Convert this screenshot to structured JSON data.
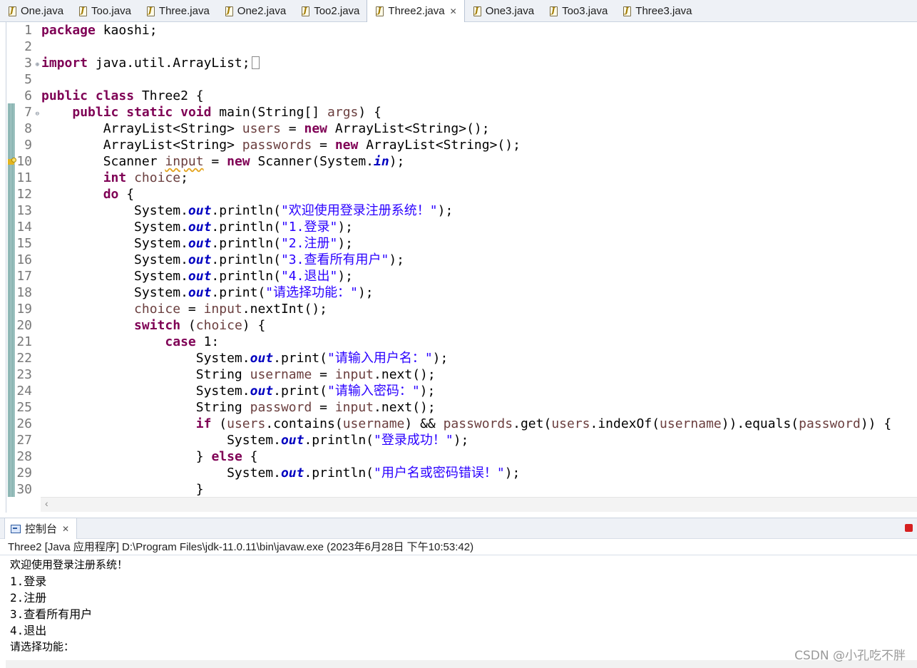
{
  "editor_tabs": [
    {
      "label": "One.java",
      "active": false
    },
    {
      "label": "Too.java",
      "active": false
    },
    {
      "label": "Three.java",
      "active": false
    },
    {
      "label": "One2.java",
      "active": false
    },
    {
      "label": "Too2.java",
      "active": false
    },
    {
      "label": "Three2.java",
      "active": true
    },
    {
      "label": "One3.java",
      "active": false
    },
    {
      "label": "Too3.java",
      "active": false
    },
    {
      "label": "Three3.java",
      "active": false
    }
  ],
  "close_glyph": "✕",
  "code": {
    "line_numbers": [
      "1",
      "2",
      "3",
      "5",
      "6",
      "7",
      "8",
      "9",
      "10",
      "11",
      "12",
      "13",
      "14",
      "15",
      "16",
      "17",
      "18",
      "19",
      "20",
      "21",
      "22",
      "23",
      "24",
      "25",
      "26",
      "27",
      "28",
      "29",
      "30"
    ],
    "lines": {
      "l1": {
        "kw": "package",
        "rest": " kaoshi;"
      },
      "l3": {
        "kw": "import",
        "rest": " java.util.ArrayList;"
      },
      "l6": {
        "kw1": "public",
        "kw2": "class",
        "rest": " Three2 {"
      },
      "l7": {
        "indent": "    ",
        "kw1": "public",
        "kw2": "static",
        "kw3": "void",
        "rest1": " main(String[] ",
        "args": "args",
        "rest2": ") {"
      },
      "l8": {
        "indent": "        ",
        "t1": "ArrayList<String> ",
        "v": "users",
        "t2": " = ",
        "kw": "new",
        "t3": " ArrayList<String>();"
      },
      "l9": {
        "indent": "        ",
        "t1": "ArrayList<String> ",
        "v": "passwords",
        "t2": " = ",
        "kw": "new",
        "t3": " ArrayList<String>();"
      },
      "l10": {
        "indent": "        ",
        "t1": "Scanner ",
        "v": "input",
        "t2": " = ",
        "kw": "new",
        "t3": " Scanner(System.",
        "fd": "in",
        "t4": ");"
      },
      "l11": {
        "indent": "        ",
        "kw": "int",
        "sp": " ",
        "v": "choice",
        "t": ";"
      },
      "l12": {
        "indent": "        ",
        "kw": "do",
        "t": " {"
      },
      "l13": {
        "indent": "            ",
        "t1": "System.",
        "fd": "out",
        "t2": ".println(",
        "s": "\"欢迎使用登录注册系统！\"",
        "t3": ");"
      },
      "l14": {
        "indent": "            ",
        "t1": "System.",
        "fd": "out",
        "t2": ".println(",
        "s": "\"1.登录\"",
        "t3": ");"
      },
      "l15": {
        "indent": "            ",
        "t1": "System.",
        "fd": "out",
        "t2": ".println(",
        "s": "\"2.注册\"",
        "t3": ");"
      },
      "l16": {
        "indent": "            ",
        "t1": "System.",
        "fd": "out",
        "t2": ".println(",
        "s": "\"3.查看所有用户\"",
        "t3": ");"
      },
      "l17": {
        "indent": "            ",
        "t1": "System.",
        "fd": "out",
        "t2": ".println(",
        "s": "\"4.退出\"",
        "t3": ");"
      },
      "l18": {
        "indent": "            ",
        "t1": "System.",
        "fd": "out",
        "t2": ".print(",
        "s": "\"请选择功能：\"",
        "t3": ");"
      },
      "l19": {
        "indent": "            ",
        "v1": "choice",
        "t1": " = ",
        "v2": "input",
        "t2": ".nextInt();"
      },
      "l20": {
        "indent": "            ",
        "kw": "switch",
        "t1": " (",
        "v": "choice",
        "t2": ") {"
      },
      "l21": {
        "indent": "                ",
        "kw": "case",
        "t": " 1:"
      },
      "l22": {
        "indent": "                    ",
        "t1": "System.",
        "fd": "out",
        "t2": ".print(",
        "s": "\"请输入用户名：\"",
        "t3": ");"
      },
      "l23": {
        "indent": "                    ",
        "t1": "String ",
        "v1": "username",
        "t2": " = ",
        "v2": "input",
        "t3": ".next();"
      },
      "l24": {
        "indent": "                    ",
        "t1": "System.",
        "fd": "out",
        "t2": ".print(",
        "s": "\"请输入密码：\"",
        "t3": ");"
      },
      "l25": {
        "indent": "                    ",
        "t1": "String ",
        "v1": "password",
        "t2": " = ",
        "v2": "input",
        "t3": ".next();"
      },
      "l26": {
        "indent": "                    ",
        "kw": "if",
        "t1": " (",
        "v1": "users",
        "t2": ".contains(",
        "v2": "username",
        "t3": ") && ",
        "v3": "passwords",
        "t4": ".get(",
        "v4": "users",
        "t5": ".indexOf(",
        "v5": "username",
        "t6": ")).equals(",
        "v6": "password",
        "t7": ")) {"
      },
      "l27": {
        "indent": "                        ",
        "t1": "System.",
        "fd": "out",
        "t2": ".println(",
        "s": "\"登录成功！\"",
        "t3": ");"
      },
      "l28": {
        "indent": "                    ",
        "t1": "} ",
        "kw": "else",
        "t2": " {"
      },
      "l29": {
        "indent": "                        ",
        "t1": "System.",
        "fd": "out",
        "t2": ".println(",
        "s": "\"用户名或密码错误！\"",
        "t3": ");"
      },
      "l30": {
        "indent": "                    ",
        "t": "}"
      }
    }
  },
  "fold_glyphs": {
    "expand": "⊕",
    "collapse": "⊖"
  },
  "hscroll_arrow": "‹",
  "console": {
    "tab_label": "控制台",
    "header": "Three2 [Java 应用程序] D:\\Program Files\\jdk-11.0.11\\bin\\javaw.exe  (2023年6月28日 下午10:53:42)",
    "output": [
      "欢迎使用登录注册系统！",
      "1.登录",
      "2.注册",
      "3.查看所有用户",
      "4.退出",
      "请选择功能："
    ]
  },
  "watermark": "CSDN @小孔吃不胖",
  "colors": {
    "keyword": "#7f0055",
    "string": "#2a00ff",
    "field": "#0000c0",
    "local_var": "#6a3e3e",
    "stop": "#d61f1f"
  }
}
